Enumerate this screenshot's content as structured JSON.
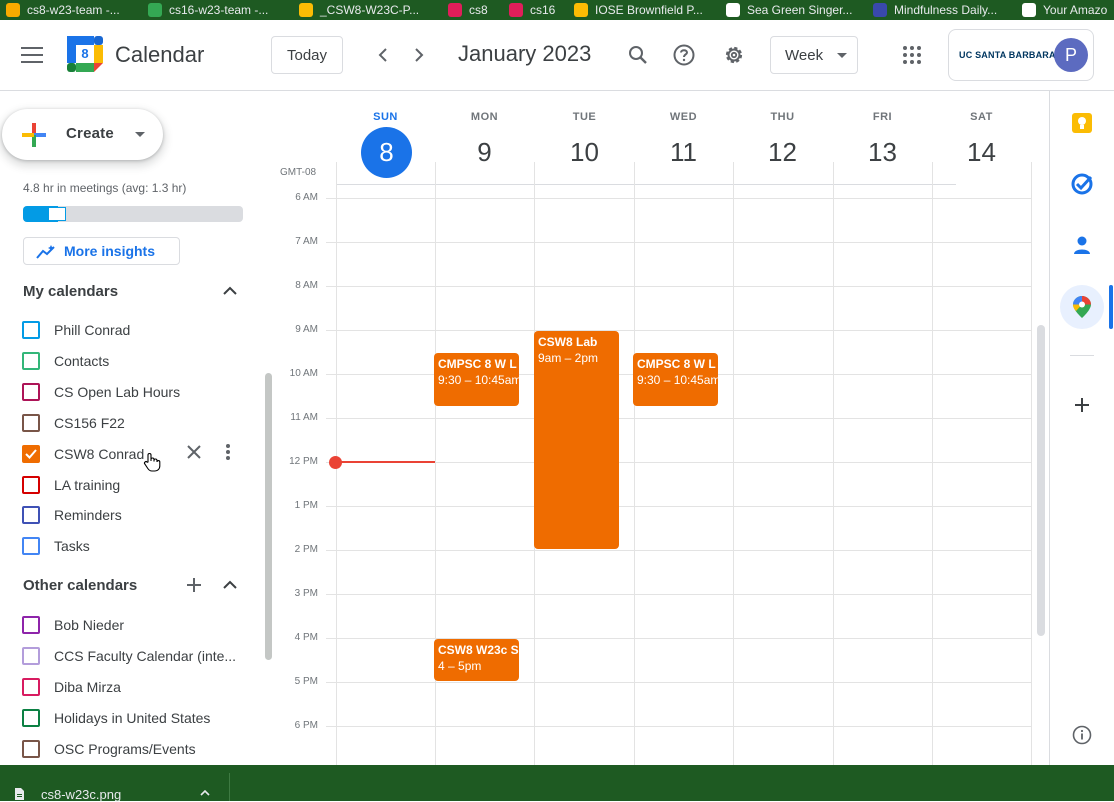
{
  "bookmarks": [
    {
      "label": "cs8-w23-team -...",
      "color": "#f9ab00"
    },
    {
      "label": "cs16-w23-team -...",
      "color": "#34a853"
    },
    {
      "label": "_CSW8-W23C-P...",
      "color": "#fbbc04"
    },
    {
      "label": "cs8",
      "color": "#e01e5a"
    },
    {
      "label": "cs16",
      "color": "#e01e5a"
    },
    {
      "label": "IOSE Brownfield P...",
      "color": "#fbbc04"
    },
    {
      "label": "Sea Green Singer...",
      "color": "#ffffff"
    },
    {
      "label": "Mindfulness Daily...",
      "color": "#3949ab"
    },
    {
      "label": "Your Amazo",
      "color": "#ffffff"
    }
  ],
  "header": {
    "app_title": "Calendar",
    "logo_day": "8",
    "today_label": "Today",
    "month_title": "January 2023",
    "view_label": "Week",
    "org_label": "UC SANTA BARBARA",
    "avatar_letter": "P"
  },
  "sidebar": {
    "create_label": "Create",
    "insight_text": "4.8 hr in meetings (avg: 1.3 hr)",
    "insight_fraction": 0.16,
    "more_insights_label": "More insights",
    "my_calendars_title": "My calendars",
    "my_calendars": [
      {
        "label": "Phill Conrad",
        "color": "#039be5",
        "checked": false
      },
      {
        "label": "Contacts",
        "color": "#33b679",
        "checked": false
      },
      {
        "label": "CS Open Lab Hours",
        "color": "#ad1457",
        "checked": false
      },
      {
        "label": "CS156 F22",
        "color": "#795548",
        "checked": false
      },
      {
        "label": "CSW8 Conrad",
        "color": "#ef6c00",
        "checked": true
      },
      {
        "label": "LA training",
        "color": "#d50000",
        "checked": false
      },
      {
        "label": "Reminders",
        "color": "#3f51b5",
        "checked": false
      },
      {
        "label": "Tasks",
        "color": "#4285f4",
        "checked": false
      }
    ],
    "other_calendars_title": "Other calendars",
    "other_calendars": [
      {
        "label": "Bob Nieder",
        "color": "#8e24aa",
        "checked": false
      },
      {
        "label": "CCS Faculty Calendar (inte...",
        "color": "#b39ddb",
        "checked": false
      },
      {
        "label": "Diba Mirza",
        "color": "#d81b60",
        "checked": false
      },
      {
        "label": "Holidays in United States",
        "color": "#0b8043",
        "checked": false
      },
      {
        "label": "OSC Programs/Events",
        "color": "#795548",
        "checked": false
      }
    ]
  },
  "week": {
    "timezone": "GMT-08",
    "days": [
      {
        "name": "SUN",
        "num": "8",
        "today": true
      },
      {
        "name": "MON",
        "num": "9",
        "today": false
      },
      {
        "name": "TUE",
        "num": "10",
        "today": false
      },
      {
        "name": "WED",
        "num": "11",
        "today": false
      },
      {
        "name": "THU",
        "num": "12",
        "today": false
      },
      {
        "name": "FRI",
        "num": "13",
        "today": false
      },
      {
        "name": "SAT",
        "num": "14",
        "today": false
      }
    ],
    "hours": [
      "6 AM",
      "7 AM",
      "8 AM",
      "9 AM",
      "10 AM",
      "11 AM",
      "12 PM",
      "1 PM",
      "2 PM",
      "3 PM",
      "4 PM",
      "5 PM",
      "6 PM"
    ]
  },
  "events": [
    {
      "title": "CMPSC 8 W L",
      "time": "9:30 – 10:45am",
      "day": 1,
      "start": 9.5,
      "end": 10.75
    },
    {
      "title": "CSW8 Lab",
      "time": "9am – 2pm",
      "day": 2,
      "start": 9.0,
      "end": 14.0
    },
    {
      "title": "CMPSC 8 W L",
      "time": "9:30 – 10:45am",
      "day": 3,
      "start": 9.5,
      "end": 10.75
    },
    {
      "title": "CSW8 W23c S",
      "time": "4 – 5pm",
      "day": 1,
      "start": 16.0,
      "end": 17.0
    }
  ],
  "current_time": {
    "day": 0,
    "hour": 12.0
  },
  "download": {
    "filename": "cs8-w23c.png"
  },
  "colors": {
    "event": "#ef6c00",
    "accent": "#1a73e8",
    "now": "#ea4335"
  }
}
